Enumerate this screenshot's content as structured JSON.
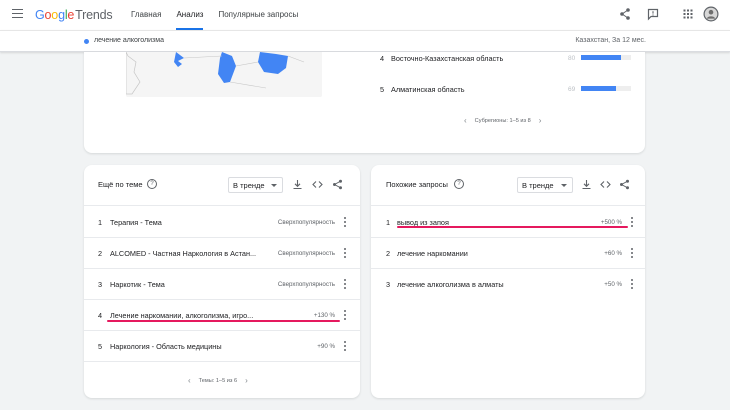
{
  "header": {
    "logo": {
      "google": [
        "G",
        "o",
        "o",
        "g",
        "l",
        "e"
      ],
      "trends": "Trends"
    },
    "tabs": [
      {
        "label": "Главная",
        "active": false
      },
      {
        "label": "Анализ",
        "active": true
      },
      {
        "label": "Популярные запросы",
        "active": false
      }
    ],
    "icons": [
      "share-icon",
      "feedback-icon",
      "apps-icon",
      "avatar"
    ]
  },
  "term_bar": {
    "term": "лечение алкоголизма",
    "term_color": "#4285f4",
    "region_period": "Казахстан, За 12 мес."
  },
  "regions": {
    "rows": [
      {
        "index": "4",
        "name": "Восточно-Казахстанская область",
        "value": "80",
        "value_num": 80
      },
      {
        "index": "5",
        "name": "Алматинская область",
        "value": "69",
        "value_num": 69
      }
    ],
    "pager": "Субрегионы: 1–5 из 8"
  },
  "topics": {
    "title": "Ещё по теме",
    "filter": "В тренде",
    "rows": [
      {
        "index": "1",
        "label": "Терапия - Тема",
        "value": "Сверхпопулярность"
      },
      {
        "index": "2",
        "label": "ALCOMED - Частная Наркология в Астан...",
        "value": "Сверхпопулярность"
      },
      {
        "index": "3",
        "label": "Наркотик - Тема",
        "value": "Сверхпопулярность"
      },
      {
        "index": "4",
        "label": "Лечение наркомании, алкоголизма, игро...",
        "value": "+130 %"
      },
      {
        "index": "5",
        "label": "Наркология - Область медицины",
        "value": "+90 %"
      }
    ],
    "pager": "Темы: 1–5 из 6"
  },
  "queries": {
    "title": "Похожие запросы",
    "filter": "В тренде",
    "rows": [
      {
        "index": "1",
        "label": "вывод из запоя",
        "value": "+500 %"
      },
      {
        "index": "2",
        "label": "лечение наркомании",
        "value": "+60 %"
      },
      {
        "index": "3",
        "label": "лечение алкоголизма в алматы",
        "value": "+50 %"
      }
    ]
  },
  "colors": {
    "accent": "#1a73e8",
    "bar": "#4285f4",
    "highlight": "#e5195e"
  }
}
